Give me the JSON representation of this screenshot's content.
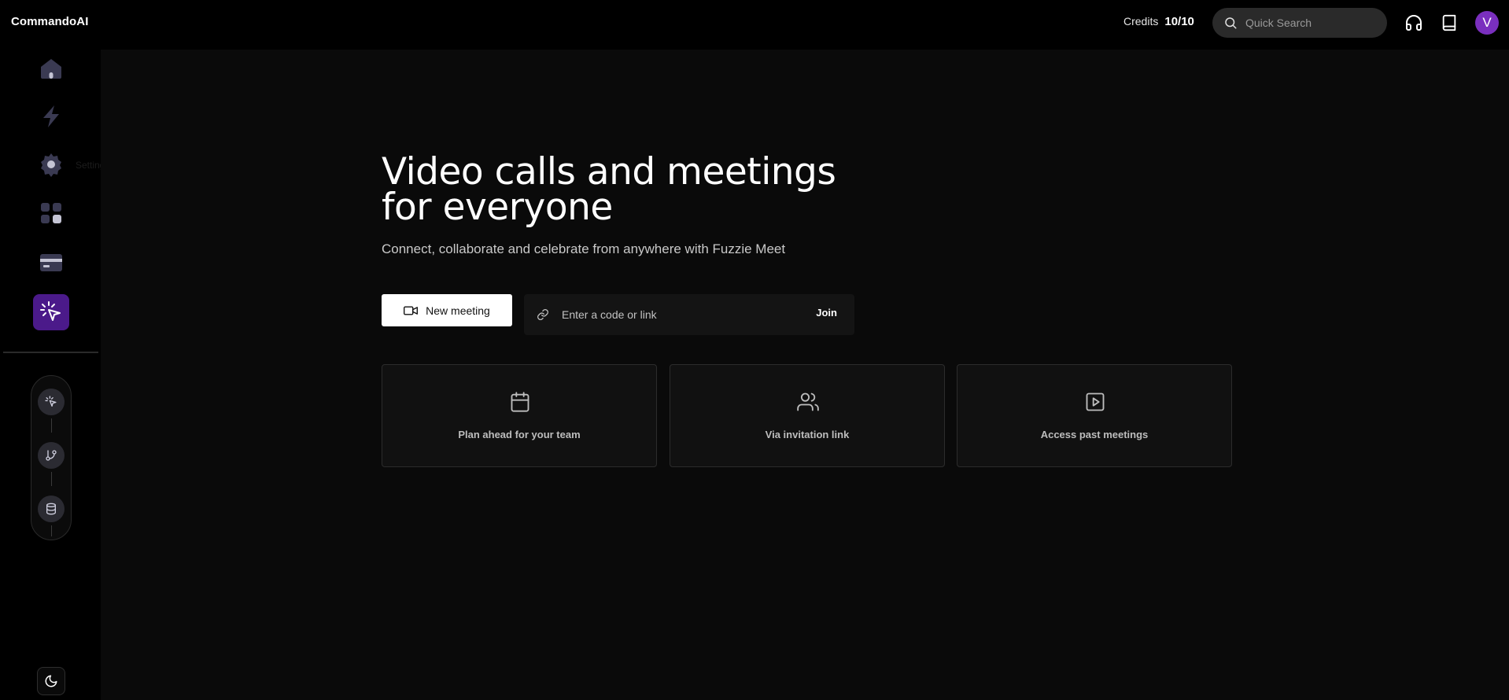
{
  "app": {
    "title": "CommandoAI"
  },
  "header": {
    "credits_label": "Credits",
    "credits_value": "10/10",
    "search_placeholder": "Quick Search",
    "avatar_initial": "V"
  },
  "sidebar": {
    "items": [
      {
        "name": "home",
        "icon": "home-icon"
      },
      {
        "name": "automations",
        "icon": "lightning-icon"
      },
      {
        "name": "settings",
        "icon": "gear-icon",
        "tooltip": "Settings"
      },
      {
        "name": "connections",
        "icon": "grid-icon"
      },
      {
        "name": "billing",
        "icon": "credit-card-icon"
      },
      {
        "name": "meetings",
        "icon": "cursor-click-icon",
        "active": true
      }
    ],
    "pipeline": [
      "cursor-click-icon",
      "git-branch-icon",
      "database-icon"
    ],
    "theme_icon": "moon-icon"
  },
  "main": {
    "headline": "Video calls and meetings for everyone",
    "subline": "Connect, collaborate and celebrate from anywhere with Fuzzie Meet",
    "new_meeting_label": "New meeting",
    "join_placeholder": "Enter a code or link",
    "join_label": "Join",
    "cards": [
      {
        "label": "Plan ahead for your team",
        "icon": "calendar-icon"
      },
      {
        "label": "Via invitation link",
        "icon": "users-icon"
      },
      {
        "label": "Access past meetings",
        "icon": "play-square-icon"
      }
    ]
  },
  "colors": {
    "accent": "#4b1a8a",
    "avatar": "#7a2fbe",
    "background": "#0a0a0a"
  }
}
